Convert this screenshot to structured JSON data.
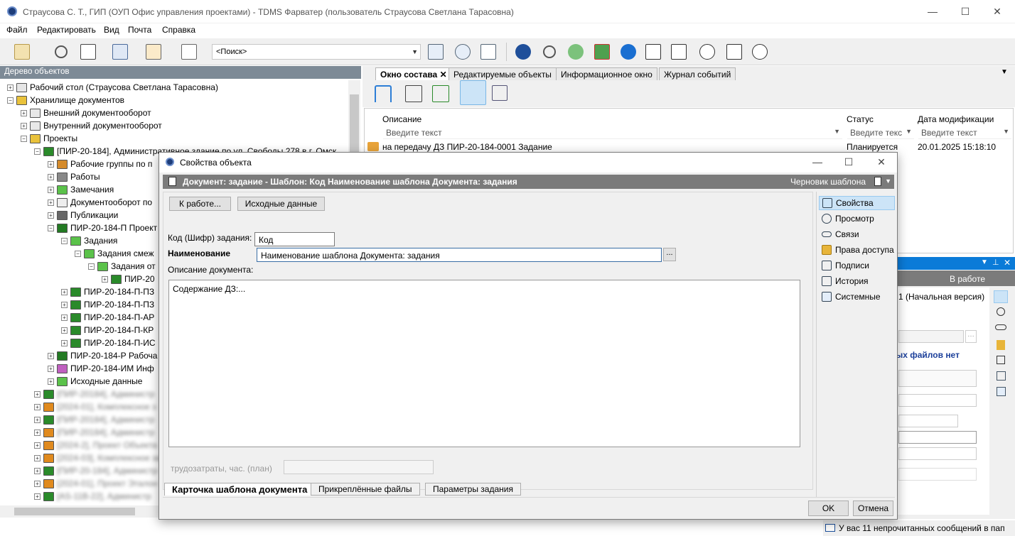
{
  "window": {
    "title": "Страусова С. Т., ГИП (ОУП Офис управления проектами) - TDMS Фарватер (пользователь Страусова Светлана Тарасовна)"
  },
  "menu": [
    "Файл",
    "Редактировать",
    "Вид",
    "Почта",
    "Справка"
  ],
  "search": {
    "text": "<Поиск>"
  },
  "left_panel": {
    "title": "Дерево объектов"
  },
  "tree": [
    {
      "label": "Рабочий стол (Страусова Светлана Тарасовна)",
      "level": 0,
      "sign": "+",
      "color": "#e6e6e6"
    },
    {
      "label": "Хранилище документов",
      "level": 0,
      "sign": "−",
      "color": "#e9c23b"
    },
    {
      "label": "Внешний документооборот",
      "level": 1,
      "sign": "+",
      "color": "#e8e8e8"
    },
    {
      "label": "Внутренний документооборот",
      "level": 1,
      "sign": "+",
      "color": "#e8e8e8"
    },
    {
      "label": "Проекты",
      "level": 1,
      "sign": "−",
      "color": "#e9c23b"
    },
    {
      "label": "[ПИР-20-184], Административное здание по ул. Свободы 278 в г. Омск",
      "level": 2,
      "sign": "−",
      "color": "#2a8a2a"
    },
    {
      "label": "Рабочие группы по п",
      "level": 3,
      "sign": "+",
      "color": "#d58b2b"
    },
    {
      "label": "Работы",
      "level": 3,
      "sign": "+",
      "color": "#888"
    },
    {
      "label": "Замечания",
      "level": 3,
      "sign": "+",
      "color": "#5bc24a"
    },
    {
      "label": "Документооборот по",
      "level": 3,
      "sign": "+",
      "color": "#eee"
    },
    {
      "label": "Публикации",
      "level": 3,
      "sign": "+",
      "color": "#666"
    },
    {
      "label": "ПИР-20-184-П Проект",
      "level": 3,
      "sign": "−",
      "color": "#237a23"
    },
    {
      "label": "Задания",
      "level": 4,
      "sign": "−",
      "color": "#5bc24a"
    },
    {
      "label": "Задания смеж",
      "level": 5,
      "sign": "−",
      "color": "#5bc24a"
    },
    {
      "label": "Задания от",
      "level": 6,
      "sign": "−",
      "color": "#5bc24a"
    },
    {
      "label": "ПИР-20",
      "level": 7,
      "sign": "+",
      "color": "#2a8a2a"
    },
    {
      "label": "ПИР-20-184-П-ПЗ",
      "level": 4,
      "sign": "+",
      "color": "#2a8a2a"
    },
    {
      "label": "ПИР-20-184-П-ПЗ",
      "level": 4,
      "sign": "+",
      "color": "#2a8a2a"
    },
    {
      "label": "ПИР-20-184-П-АР",
      "level": 4,
      "sign": "+",
      "color": "#2a8a2a"
    },
    {
      "label": "ПИР-20-184-П-КР",
      "level": 4,
      "sign": "+",
      "color": "#2a8a2a"
    },
    {
      "label": "ПИР-20-184-П-ИС",
      "level": 4,
      "sign": "+",
      "color": "#2a8a2a"
    },
    {
      "label": "ПИР-20-184-Р Рабоча",
      "level": 3,
      "sign": "+",
      "color": "#237a23"
    },
    {
      "label": "ПИР-20-184-ИМ Инф",
      "level": 3,
      "sign": "+",
      "color": "#c060c0"
    },
    {
      "label": "Исходные данные",
      "level": 3,
      "sign": "+",
      "color": "#5bc24a"
    },
    {
      "label": "[ПИР-20184], Администр",
      "level": 2,
      "sign": "+",
      "color": "#2a8a2a",
      "blur": true
    },
    {
      "label": "[2024-01], Комплексное з",
      "level": 2,
      "sign": "+",
      "color": "#e08a1e",
      "blur": true
    },
    {
      "label": "[ПИР-20184], Администр",
      "level": 2,
      "sign": "+",
      "color": "#2a8a2a",
      "blur": true
    },
    {
      "label": "[ПИР-20184], Администр",
      "level": 2,
      "sign": "+",
      "color": "#e08a1e",
      "blur": true
    },
    {
      "label": "[2024-2], Проект Объекта",
      "level": 2,
      "sign": "+",
      "color": "#e08a1e",
      "blur": true
    },
    {
      "label": "[2024-03], Комплексное за",
      "level": 2,
      "sign": "+",
      "color": "#e08a1e",
      "blur": true
    },
    {
      "label": "[ПИР-20-184], Администр",
      "level": 2,
      "sign": "+",
      "color": "#2a8a2a",
      "blur": true
    },
    {
      "label": "[2024-01], Проект Эталон",
      "level": 2,
      "sign": "+",
      "color": "#e08a1e",
      "blur": true
    },
    {
      "label": "[AS-11B-22], Администр",
      "level": 2,
      "sign": "+",
      "color": "#2a8a2a",
      "blur": true
    }
  ],
  "tabs": [
    "Окно состава",
    "Редактируемые объекты",
    "Информационное окно",
    "Журнал событий"
  ],
  "grid": {
    "columns": [
      "Описание",
      "Статус",
      "Дата модификации"
    ],
    "filter_placeholder": "Введите текст",
    "filter_short": "Введите текс",
    "row": {
      "desc": "на передачу ДЗ ПИР-20-184-0001 Задание",
      "status": "Планируется",
      "date": "20.01.2025 15:18:10"
    }
  },
  "right_panel2": {
    "status": "В работе",
    "version": "1 (Начальная версия)",
    "files": "ых файлов нет"
  },
  "statusbar": "У вас 11 непрочитанных сообщений в пап",
  "dialog": {
    "title": "Свойства объекта",
    "header": "Документ: задание - Шаблон: Код  Наименование шаблона Документа: задания",
    "header_right": "Черновик шаблона",
    "btn_work": "К работе...",
    "btn_source": "Исходные данные",
    "code_label": "Код (Шифр) задания:",
    "code_value": "Код",
    "name_label": "Наименование",
    "name_value": "Наименование шаблона Документа: задания",
    "desc_label": "Описание документа:",
    "desc_value": "Содержание ДЗ:...",
    "labor_label": "трудозатраты, час. (план)",
    "ellipsis": "...",
    "side_items": [
      "Свойства",
      "Просмотр",
      "Связи",
      "Права доступа",
      "Подписи",
      "История",
      "Системные"
    ],
    "bottom_tabs": [
      "Карточка шаблона документа",
      "Прикреплённые файлы",
      "Параметры задания"
    ],
    "ok": "OK",
    "cancel": "Отмена"
  }
}
